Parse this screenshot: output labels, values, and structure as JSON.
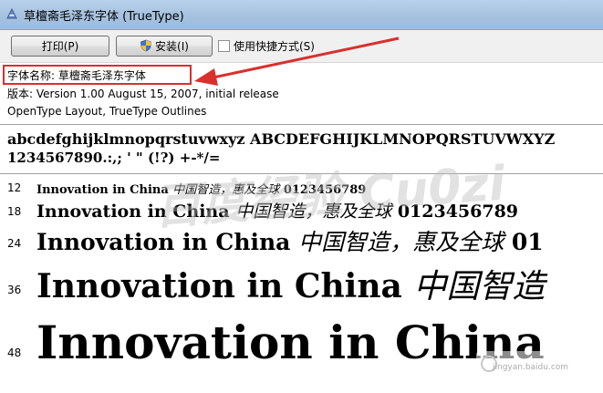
{
  "window": {
    "title": "草檀斋毛泽东字体 (TrueType)"
  },
  "toolbar": {
    "print_label": "打印(P)",
    "install_label": "安装(I)",
    "shortcut_label": "使用快捷方式(S)"
  },
  "info": {
    "font_name": "字体名称: 草檀斋毛泽东字体",
    "version": "版本: Version 1.00 August 15, 2007, initial release",
    "outlines": "OpenType Layout, TrueType Outlines"
  },
  "charset": {
    "letters": "abcdefghijklmnopqrstuvwxyz ABCDEFGHIJKLMNOPQRSTUVWXYZ",
    "digits": "1234567890.:,; ' \" (!?) +-*/="
  },
  "samples": [
    {
      "size": "12",
      "text": "Innovation in China",
      "cjk": "中国智造，惠及全球",
      "digits": "0123456789"
    },
    {
      "size": "18",
      "text": "Innovation in China",
      "cjk": "中国智造，惠及全球",
      "digits": "0123456789"
    },
    {
      "size": "24",
      "text": "Innovation in China",
      "cjk": "中国智造，惠及全球",
      "digits": "01"
    },
    {
      "size": "36",
      "text": "Innovation in China",
      "cjk": "中国智造",
      "digits": ""
    },
    {
      "size": "48",
      "text": "Innovation in China",
      "cjk": "",
      "digits": ""
    }
  ],
  "watermark": {
    "text": "百度经验 Cu0zi",
    "site": "jingyan.baidu.com"
  },
  "colors": {
    "highlight": "#d9302c",
    "titlebar": "#a7c3e0"
  }
}
